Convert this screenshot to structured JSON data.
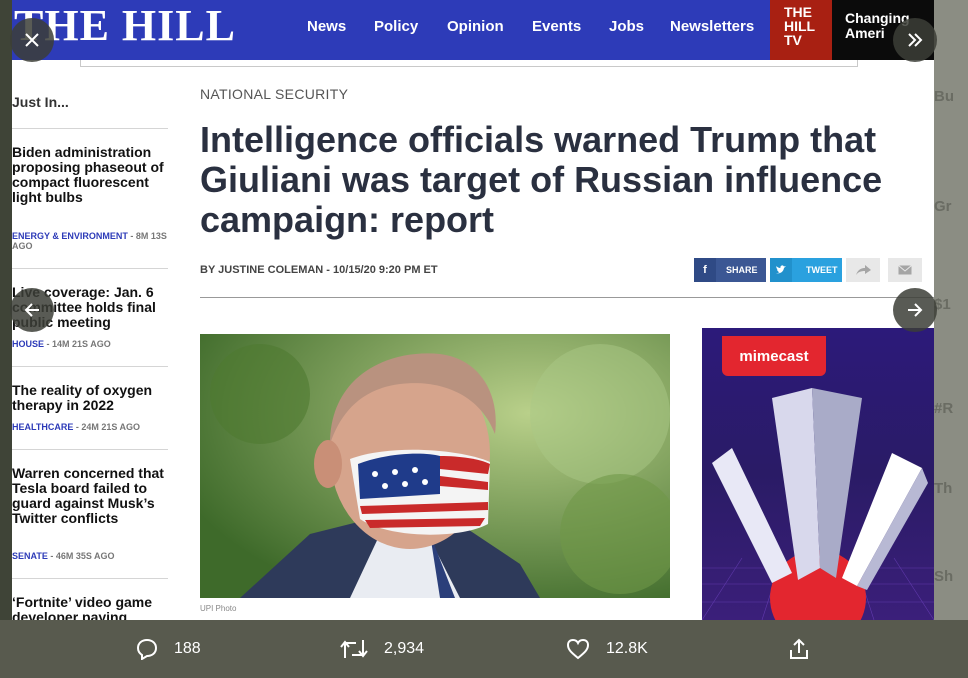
{
  "header": {
    "logo": "THE HILL",
    "nav": [
      "News",
      "Policy",
      "Opinion",
      "Events",
      "Jobs",
      "Newsletters"
    ],
    "tv_label": [
      "THE",
      "HILL",
      "TV"
    ],
    "promo": [
      "Changing",
      "Ameri"
    ]
  },
  "sidebar": {
    "heading": "Just In...",
    "items": [
      {
        "title": "Biden administration proposing phaseout of compact fluorescent light bulbs",
        "category": "ENERGY & ENVIRONMENT",
        "age": "8M 13S AGO"
      },
      {
        "title": "Live coverage: Jan. 6 committee holds final public meeting",
        "category": "HOUSE",
        "age": "14M 21S AGO"
      },
      {
        "title": "The reality of oxygen therapy in 2022",
        "category": "HEALTHCARE",
        "age": "24M 21S AGO"
      },
      {
        "title": "Warren concerned that Tesla board failed to guard against Musk’s Twitter conflicts",
        "category": "SENATE",
        "age": "46M 35S AGO"
      },
      {
        "title": "‘Fortnite’ video game developer paying",
        "category": "",
        "age": ""
      }
    ]
  },
  "article": {
    "section": "NATIONAL SECURITY",
    "headline": "Intelligence officials warned Trump that Giuliani was target of Russian influence campaign: report",
    "byline": "BY JUSTINE COLEMAN - 10/15/20 9:20 PM ET",
    "share_fb": "SHARE",
    "share_tw": "TWEET",
    "photo_caption": "UPI Photo"
  },
  "ad": {
    "brand": "mimecast"
  },
  "tweet_actions": {
    "replies": "188",
    "retweets": "2,934",
    "likes": "12.8K"
  },
  "icons": [
    "close-icon",
    "expand-icon",
    "arrow-left-icon",
    "arrow-right-icon",
    "reply-icon",
    "retweet-icon",
    "like-icon",
    "share-icon"
  ]
}
